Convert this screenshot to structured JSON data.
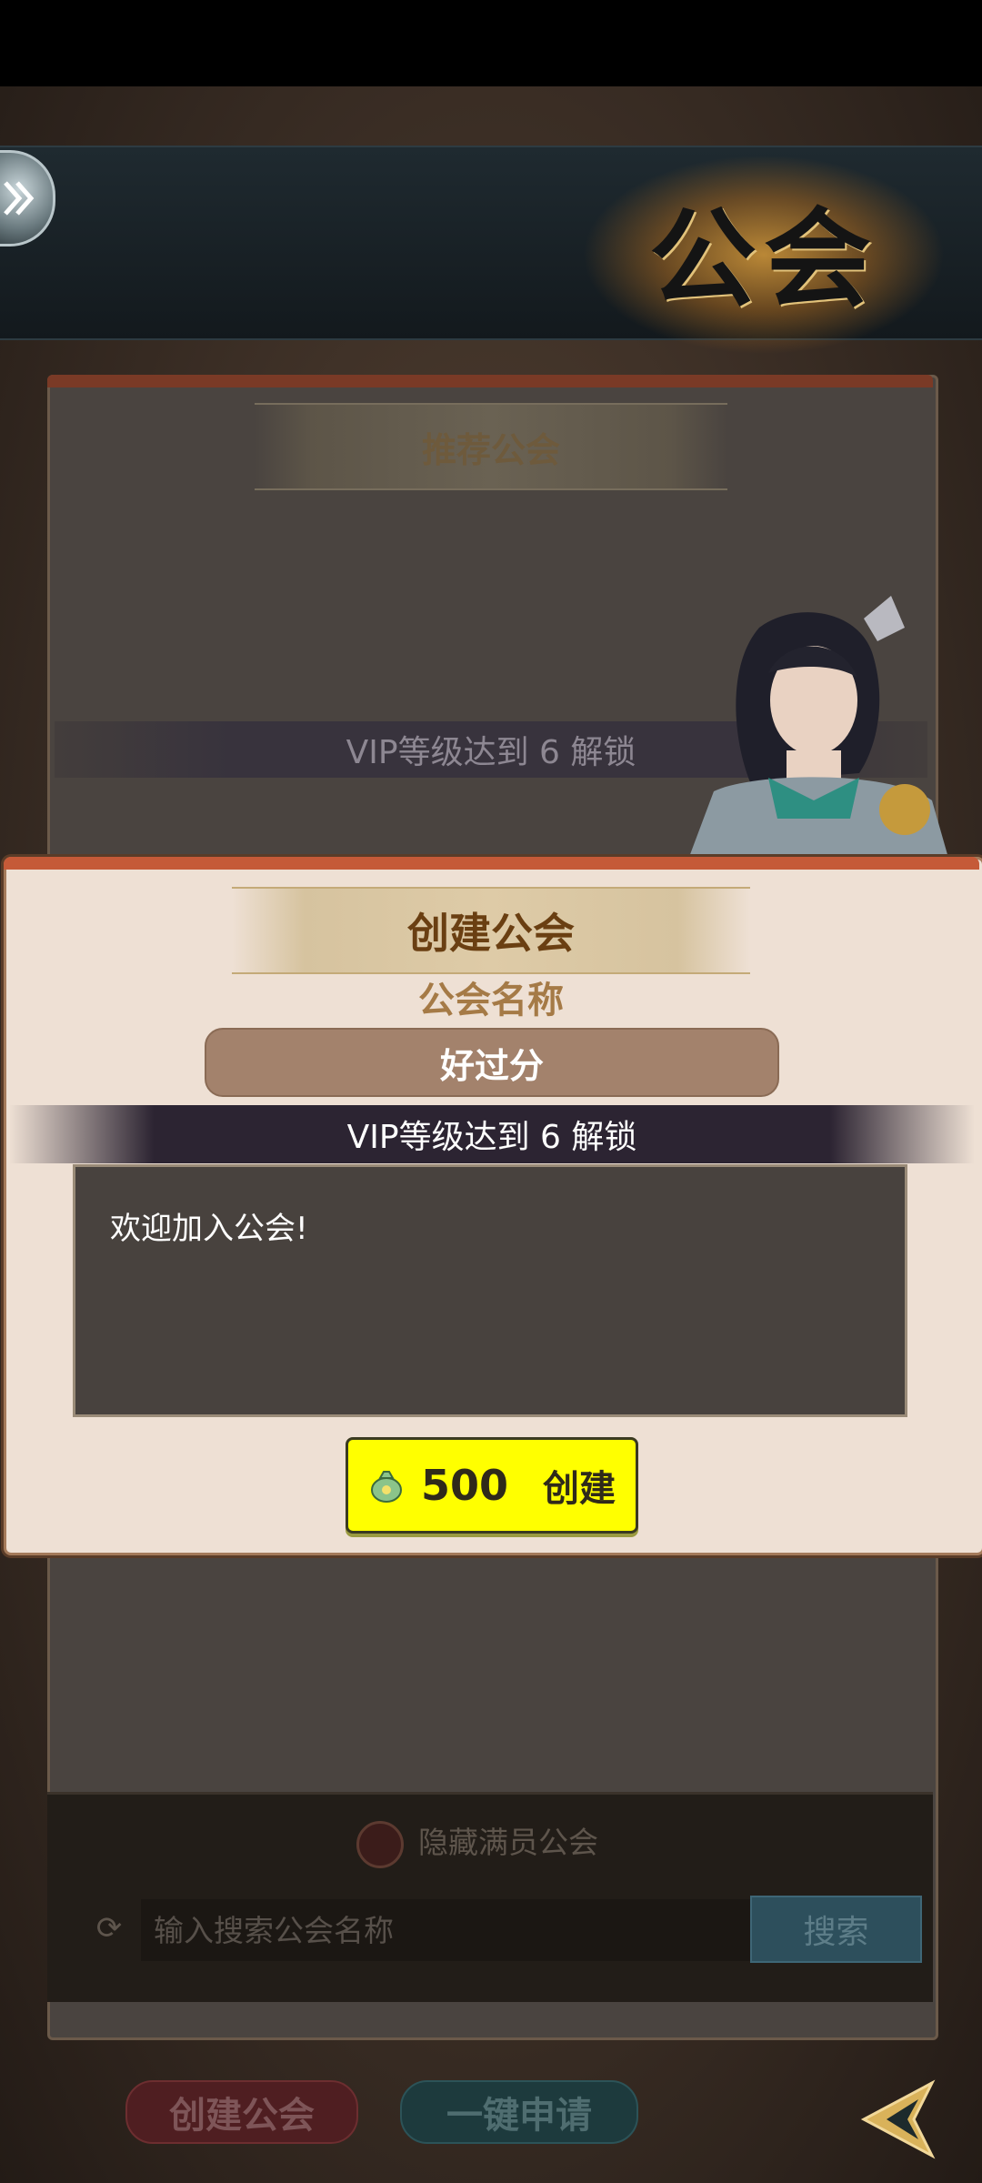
{
  "header": {
    "title": "公会"
  },
  "recommend": {
    "title": "推荐公会",
    "vip_text": "VIP等级达到 6 解锁"
  },
  "modal": {
    "title": "创建公会",
    "name_label": "公会名称",
    "name_value": "好过分",
    "vip_text": "VIP等级达到 6 解锁",
    "motto": "欢迎加入公会!",
    "cost": "500",
    "create_label": "创建"
  },
  "search": {
    "hide_full_label": "隐藏满员公会",
    "placeholder": "输入搜索公会名称",
    "button_label": "搜索"
  },
  "bottom": {
    "create_label": "创建公会",
    "apply_label": "一键申请"
  },
  "colors": {
    "create_button": "#ffff00",
    "modal_bg": "#eee0d4"
  }
}
